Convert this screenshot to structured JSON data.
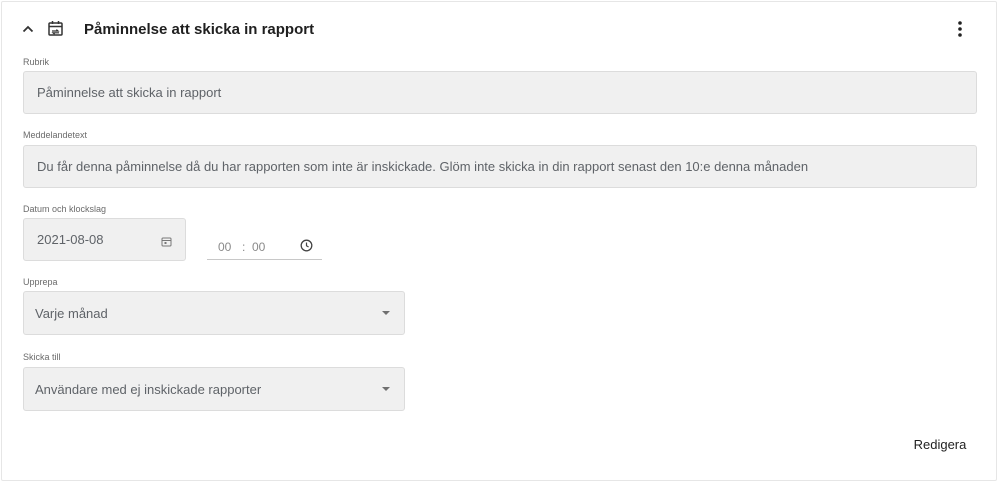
{
  "header": {
    "collapse_icon": "chevron-up-icon",
    "type_icon": "calendar-repeat-icon",
    "title": "Påminnelse att skicka in rapport",
    "more_icon": "more-vertical-icon"
  },
  "form": {
    "subject": {
      "label": "Rubrik",
      "value": "Påminnelse att skicka in rapport"
    },
    "message": {
      "label": "Meddelandetext",
      "value": "Du får denna påminnelse då du har rapporten som inte är inskickade. Glöm inte skicka in din rapport senast den 10:e denna månaden"
    },
    "datetime": {
      "label": "Datum och klockslag",
      "date": "2021-08-08",
      "date_icon": "calendar-icon",
      "hours": "00",
      "separator": ":",
      "minutes": "00",
      "time_icon": "clock-icon"
    },
    "repeat": {
      "label": "Upprepa",
      "value": "Varje månad"
    },
    "send_to": {
      "label": "Skicka till",
      "value": "Användare med ej inskickade rapporter"
    }
  },
  "footer": {
    "edit_label": "Redigera"
  }
}
